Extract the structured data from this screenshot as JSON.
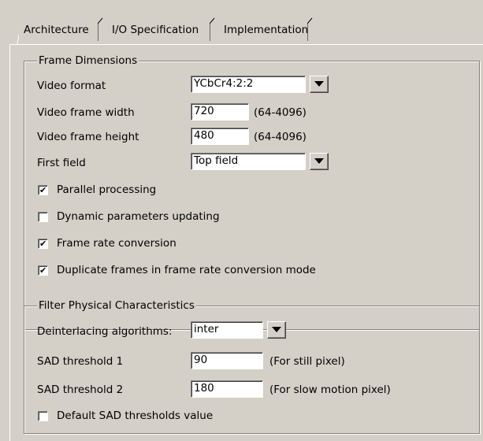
{
  "tabs": [
    {
      "label": "Architecture",
      "active": true
    },
    {
      "label": "I/O Specification",
      "active": false
    },
    {
      "label": "Implementation",
      "active": false
    }
  ],
  "frame_dimensions": {
    "legend": "Frame Dimensions",
    "video_format": {
      "label": "Video format",
      "value": "YCbCr4:2:2"
    },
    "frame_width": {
      "label": "Video frame width",
      "value": "720",
      "range": "(64-4096)"
    },
    "frame_height": {
      "label": "Video frame height",
      "value": "480",
      "range": "(64-4096)"
    },
    "first_field": {
      "label": "First field",
      "value": "Top field"
    },
    "checkboxes": [
      {
        "label": "Parallel processing",
        "checked": true
      },
      {
        "label": "Dynamic parameters updating",
        "checked": false
      },
      {
        "label": "Frame rate conversion",
        "checked": true
      },
      {
        "label": "Duplicate frames in frame rate conversion mode",
        "checked": true
      }
    ]
  },
  "filter": {
    "legend": "Filter Physical Characteristics",
    "algorithm": {
      "label": "Deinterlacing algorithms:",
      "value": "inter"
    },
    "sad1": {
      "label": "SAD threshold 1",
      "value": "90",
      "hint": "(For still pixel)"
    },
    "sad2": {
      "label": "SAD threshold 2",
      "value": "180",
      "hint": "(For slow motion pixel)"
    },
    "default_sad": {
      "label": "Default SAD thresholds value",
      "checked": false
    }
  },
  "icons": {
    "dropdown": "chevron-down-icon",
    "check": "checkmark-icon"
  }
}
